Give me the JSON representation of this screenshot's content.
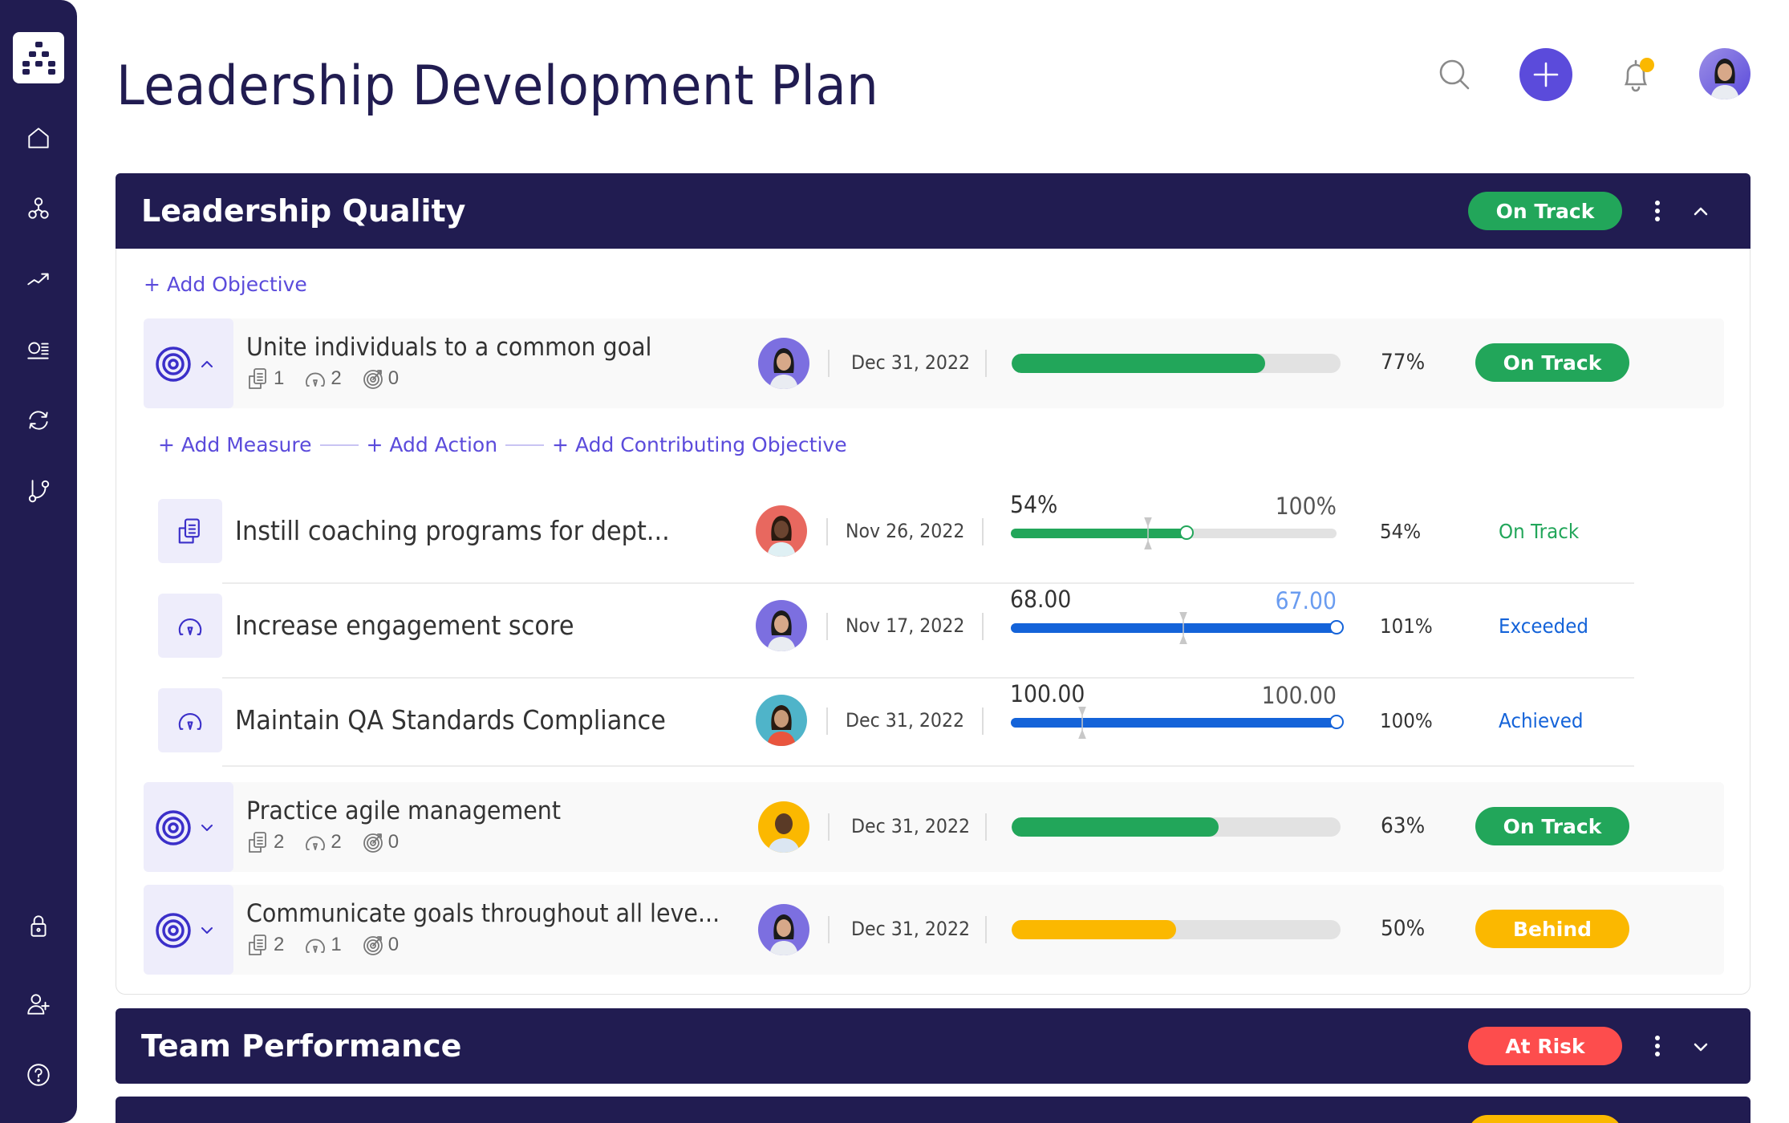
{
  "page": {
    "title": "Leadership Development Plan"
  },
  "sidebar": {
    "items": [
      {
        "name": "home",
        "icon": "home-icon"
      },
      {
        "name": "hierarchy",
        "icon": "hierarchy-icon"
      },
      {
        "name": "trends",
        "icon": "trending-up-icon"
      },
      {
        "name": "list",
        "icon": "list-icon"
      },
      {
        "name": "sync",
        "icon": "sync-icon"
      },
      {
        "name": "branch",
        "icon": "branch-icon"
      }
    ],
    "bottom_items": [
      {
        "name": "lock",
        "icon": "lock-icon"
      },
      {
        "name": "add-user",
        "icon": "user-plus-icon"
      },
      {
        "name": "help",
        "icon": "help-icon"
      }
    ]
  },
  "header": {
    "search_icon": "search-icon",
    "add_icon": "plus-icon",
    "notification_icon": "bell-icon",
    "has_notification": true
  },
  "colors": {
    "navy": "#211c51",
    "accent": "#5b4bdb",
    "on_track": "#22a65a",
    "behind": "#fbb800",
    "at_risk": "#fd4d4d",
    "exceeded": "#1463d9"
  },
  "sections": [
    {
      "title": "Leadership Quality",
      "status": "On Track",
      "status_color": "#22a65a",
      "expanded": true,
      "add_objective_label": "+ Add Objective",
      "objectives": [
        {
          "title": "Unite individuals to a common goal",
          "actions_count": "1",
          "measures_count": "2",
          "contributing_count": "0",
          "date": "Dec 31, 2022",
          "progress": 77,
          "progress_label": "77%",
          "progress_color": "#22a65a",
          "status": "On Track",
          "status_color": "#22a65a",
          "expanded": true,
          "add_links": [
            "+ Add Measure",
            "+ Add Action",
            "+ Add Contributing Objective"
          ],
          "measures": [
            {
              "type": "action",
              "title": "Instill coaching programs for dept...",
              "date": "Nov 26, 2022",
              "current_value": "54%",
              "target_value": "100%",
              "target_color": "#555555",
              "progress": 54,
              "expected": 42,
              "percent_label": "54%",
              "bar_color": "#22a65a",
              "status": "On Track",
              "status_color": "#22a65a"
            },
            {
              "type": "measure",
              "title": "Increase engagement score",
              "date": "Nov 17, 2022",
              "current_value": "68.00",
              "target_value": "67.00",
              "target_color": "#6a9cf0",
              "progress": 100,
              "expected": 53,
              "percent_label": "101%",
              "bar_color": "#1463d9",
              "status": "Exceeded",
              "status_color": "#1463d9"
            },
            {
              "type": "measure",
              "title": "Maintain QA Standards Compliance",
              "date": "Dec 31, 2022",
              "current_value": "100.00",
              "target_value": "100.00",
              "target_color": "#555555",
              "progress": 100,
              "expected": 22,
              "percent_label": "100%",
              "bar_color": "#1463d9",
              "status": "Achieved",
              "status_color": "#1463d9"
            }
          ]
        },
        {
          "title": "Practice agile management",
          "actions_count": "2",
          "measures_count": "2",
          "contributing_count": "0",
          "date": "Dec 31, 2022",
          "progress": 63,
          "progress_label": "63%",
          "progress_color": "#22a65a",
          "status": "On Track",
          "status_color": "#22a65a",
          "expanded": false
        },
        {
          "title": "Communicate goals throughout all leve...",
          "actions_count": "2",
          "measures_count": "1",
          "contributing_count": "0",
          "date": "Dec 31, 2022",
          "progress": 50,
          "progress_label": "50%",
          "progress_color": "#fbb800",
          "status": "Behind",
          "status_color": "#fbb800",
          "expanded": false
        }
      ]
    },
    {
      "title": "Team Performance",
      "status": "At Risk",
      "status_color": "#fd4d4d",
      "expanded": false
    },
    {
      "title": "",
      "status": "",
      "status_color": "#fbb800",
      "expanded": false
    }
  ]
}
